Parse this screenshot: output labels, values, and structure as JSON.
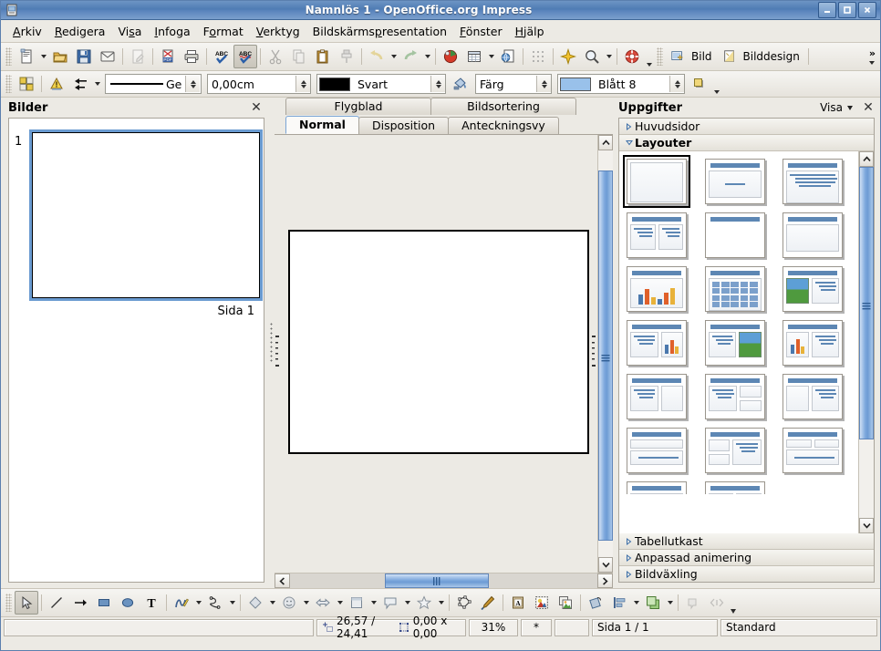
{
  "window": {
    "title": "Namnlös 1 - OpenOffice.org Impress",
    "app_icon": "impress-icon",
    "buttons": {
      "minimize": "minimize-icon",
      "maximize": "maximize-icon",
      "close": "close-icon"
    }
  },
  "menu": [
    {
      "label": "Arkiv",
      "accel": "A"
    },
    {
      "label": "Redigera",
      "accel": "R"
    },
    {
      "label": "Visa",
      "accel": "s"
    },
    {
      "label": "Infoga",
      "accel": "I"
    },
    {
      "label": "Format",
      "accel": "o"
    },
    {
      "label": "Verktyg",
      "accel": "V"
    },
    {
      "label": "Bildskärmspresentation",
      "accel": "p"
    },
    {
      "label": "Fönster",
      "accel": "F"
    },
    {
      "label": "Hjälp",
      "accel": "H"
    }
  ],
  "standard_toolbar": {
    "items": [
      {
        "name": "new-document-button",
        "icon": "new-document-icon",
        "dropdown": true
      },
      {
        "name": "open-button",
        "icon": "open-folder-icon"
      },
      {
        "name": "save-button",
        "icon": "floppy-save-icon"
      },
      {
        "name": "email-button",
        "icon": "envelope-icon"
      },
      {
        "name": "edit-file-button",
        "icon": "edit-file-icon",
        "disabled": true
      },
      {
        "name": "export-pdf-button",
        "icon": "pdf-icon"
      },
      {
        "name": "print-button",
        "icon": "printer-icon"
      },
      {
        "name": "spelling-button",
        "icon": "abc-check-icon"
      },
      {
        "name": "autospellcheck-button",
        "icon": "abc-check-red-icon",
        "active": true
      },
      {
        "name": "cut-button",
        "icon": "scissors-icon",
        "disabled": true
      },
      {
        "name": "copy-button",
        "icon": "copy-icon",
        "disabled": true
      },
      {
        "name": "paste-button",
        "icon": "clipboard-icon"
      },
      {
        "name": "clone-formatting-button",
        "icon": "paintbrush-icon",
        "disabled": true
      },
      {
        "name": "undo-button",
        "icon": "undo-arrow-icon",
        "disabled": true,
        "dropdown": true
      },
      {
        "name": "redo-button",
        "icon": "redo-arrow-icon",
        "disabled": true,
        "dropdown": true
      },
      {
        "name": "chart-button",
        "icon": "chart-icon"
      },
      {
        "name": "table-button",
        "icon": "table-icon",
        "dropdown": true
      },
      {
        "name": "hyperlink-button",
        "icon": "globe-document-icon"
      },
      {
        "name": "display-grid-button",
        "icon": "grid-icon"
      },
      {
        "name": "effects-button",
        "icon": "sparkle-icon"
      },
      {
        "name": "zoom-button",
        "icon": "magnifier-icon",
        "dropdown": true
      },
      {
        "name": "help-button",
        "icon": "lifebuoy-icon",
        "dropdown": true
      }
    ],
    "slide_label": "Bild",
    "slide_icon": "new-slide-icon",
    "design_label": "Bilddesign",
    "design_icon": "slide-design-icon",
    "overflow": "»"
  },
  "line_fill_toolbar": {
    "display_grid_icon": "grid-toggle-icon",
    "warning_icon": "warning-triangle-icon",
    "arrange_icon": "arrange-arrows-icon",
    "line_style": {
      "value": "Ge",
      "name": "line-style-combo"
    },
    "line_width": {
      "value": "0,00cm",
      "name": "line-width-spin"
    },
    "line_color": {
      "value": "Svart",
      "swatch": "#000000",
      "name": "line-color-combo"
    },
    "area_style_icon": "paint-can-icon",
    "area_style": {
      "value": "Färg",
      "name": "area-style-combo"
    },
    "area_color": {
      "value": "Blått 8",
      "swatch": "#99c1ea",
      "name": "area-color-combo"
    },
    "shadow_icon": "shadow-icon"
  },
  "slides_panel": {
    "title": "Bilder",
    "close_icon": "close-icon",
    "slides": [
      {
        "number": "1",
        "caption": "Sida 1",
        "selected": true
      }
    ]
  },
  "view_tabs": {
    "top_row": [
      {
        "label": "Flygblad",
        "active": false
      },
      {
        "label": "Bildsortering",
        "active": false
      }
    ],
    "bottom_row": [
      {
        "label": "Normal",
        "active": true
      },
      {
        "label": "Disposition",
        "active": false
      },
      {
        "label": "Anteckningsvy",
        "active": false
      }
    ]
  },
  "tasks_panel": {
    "title": "Uppgifter",
    "view_label": "Visa",
    "view_dropdown_icon": "chevron-down-icon",
    "close_icon": "close-icon",
    "sections": [
      {
        "label": "Huvudsidor",
        "expanded": false
      },
      {
        "label": "Layouter",
        "expanded": true
      }
    ],
    "bottom_sections": [
      {
        "label": "Tabellutkast",
        "expanded": false
      },
      {
        "label": "Anpassad animering",
        "expanded": false
      },
      {
        "label": "Bildväxling",
        "expanded": false
      }
    ],
    "layouts": [
      {
        "name": "layout-blank",
        "type": "blank",
        "selected": true
      },
      {
        "name": "layout-title-content",
        "type": "title-subtitle"
      },
      {
        "name": "layout-title-bullets",
        "type": "title-bullets"
      },
      {
        "name": "layout-title-two-bullets",
        "type": "two-bullets"
      },
      {
        "name": "layout-title-only",
        "type": "title-only"
      },
      {
        "name": "layout-title-blank",
        "type": "title-blankbox"
      },
      {
        "name": "layout-title-chart",
        "type": "chart"
      },
      {
        "name": "layout-title-table",
        "type": "table"
      },
      {
        "name": "layout-title-image-bullets",
        "type": "image-bullets"
      },
      {
        "name": "layout-bullets-chart",
        "type": "bullets-chart"
      },
      {
        "name": "layout-bullets-image",
        "type": "bullets-image"
      },
      {
        "name": "layout-chart-bullets",
        "type": "chart-bullets"
      },
      {
        "name": "layout-bullets-box",
        "type": "bullets-box"
      },
      {
        "name": "layout-bullets-two-box",
        "type": "bullets-two-box"
      },
      {
        "name": "layout-box-bullets",
        "type": "box-bullets"
      },
      {
        "name": "layout-box-over-bullets",
        "type": "box-over-bullets"
      },
      {
        "name": "layout-two-box-bullets",
        "type": "two-box-bullets"
      },
      {
        "name": "layout-two-box-over",
        "type": "two-box-over"
      },
      {
        "name": "layout-partial-1",
        "type": "partial"
      },
      {
        "name": "layout-partial-2",
        "type": "partial"
      }
    ]
  },
  "drawing_toolbar": {
    "items": [
      {
        "name": "select-tool",
        "icon": "arrow-cursor-icon",
        "active": true
      },
      {
        "name": "line-tool",
        "icon": "line-icon"
      },
      {
        "name": "arrow-tool",
        "icon": "arrow-line-icon"
      },
      {
        "name": "rectangle-tool",
        "icon": "rectangle-icon"
      },
      {
        "name": "ellipse-tool",
        "icon": "ellipse-icon"
      },
      {
        "name": "text-tool",
        "icon": "text-t-icon"
      },
      {
        "name": "curve-tool",
        "icon": "curve-pen-icon",
        "dropdown": true
      },
      {
        "name": "connector-tool",
        "icon": "connector-icon",
        "dropdown": true
      },
      {
        "name": "basic-shapes-tool",
        "icon": "diamond-shape-icon",
        "dropdown": true
      },
      {
        "name": "symbol-shapes-tool",
        "icon": "smiley-icon",
        "dropdown": true
      },
      {
        "name": "block-arrows-tool",
        "icon": "block-arrow-icon",
        "dropdown": true
      },
      {
        "name": "flowchart-tool",
        "icon": "flowchart-icon",
        "dropdown": true
      },
      {
        "name": "callouts-tool",
        "icon": "callout-icon",
        "dropdown": true
      },
      {
        "name": "stars-tool",
        "icon": "star-icon",
        "dropdown": true
      },
      {
        "name": "points-tool",
        "icon": "edit-points-icon"
      },
      {
        "name": "gluepoints-tool",
        "icon": "gluepoint-icon"
      },
      {
        "name": "fontwork-tool",
        "icon": "fontwork-icon"
      },
      {
        "name": "from-file-tool",
        "icon": "image-from-file-icon"
      },
      {
        "name": "gallery-tool",
        "icon": "gallery-icon"
      },
      {
        "name": "rotate-tool",
        "icon": "rotate-icon"
      },
      {
        "name": "alignment-tool",
        "icon": "align-icon",
        "dropdown": true
      },
      {
        "name": "arrange-tool",
        "icon": "arrange-objects-icon",
        "dropdown": true
      },
      {
        "name": "shadow-tool",
        "icon": "shadow-object-icon",
        "disabled": true
      },
      {
        "name": "crop-tool",
        "icon": "interaction-icon",
        "disabled": true
      }
    ],
    "overflow_icon": "chevron-down-icon"
  },
  "status_bar": {
    "info_field": "",
    "cursor_icon": "cursor-position-icon",
    "position": "26,57 / 24,41",
    "size_icon": "object-size-icon",
    "size": "0,00 x 0,00",
    "zoom": "31%",
    "modified": "*",
    "signature": "",
    "page": "Sida 1 / 1",
    "master": "Standard"
  },
  "colors": {
    "titlebar_start": "#6d94c4",
    "titlebar_end": "#4f7cb4",
    "accent_blue": "#5d87b4",
    "selection_blue": "#6a9bd1",
    "panel_bg": "#eceae4",
    "toolbar_bg": "#f1efea"
  }
}
